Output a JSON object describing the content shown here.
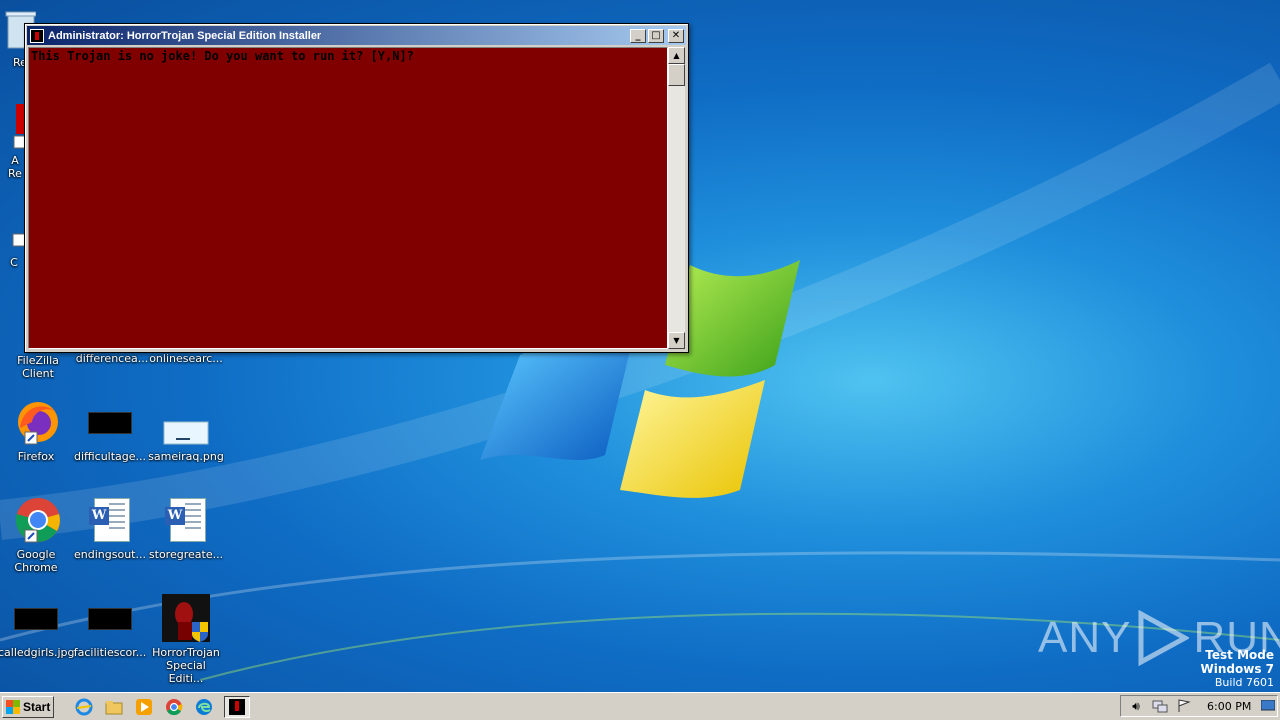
{
  "desktop": {
    "icons": [
      {
        "label": "Re",
        "kind": "recycle-bin"
      },
      {
        "label": "A",
        "kind": "partial-app"
      },
      {
        "label": "Re",
        "kind": "partial-app"
      },
      {
        "label": "C",
        "kind": "partial-app"
      },
      {
        "label": "FileZilla Client",
        "kind": "filezilla"
      },
      {
        "label": "differencea...",
        "kind": "word-doc"
      },
      {
        "label": "onlinesearc...",
        "kind": "word-doc"
      },
      {
        "label": "Firefox",
        "kind": "firefox"
      },
      {
        "label": "difficultage...",
        "kind": "black-image"
      },
      {
        "label": "sameiraq.png",
        "kind": "blank-image"
      },
      {
        "label": "Google Chrome",
        "kind": "chrome"
      },
      {
        "label": "endingsout...",
        "kind": "word-doc"
      },
      {
        "label": "storegreate...",
        "kind": "word-doc"
      },
      {
        "label": "calledgirls.jpg",
        "kind": "black-image"
      },
      {
        "label": "facilitiescor...",
        "kind": "black-image"
      },
      {
        "label": "HorrorTrojan Special Editi...",
        "kind": "installer"
      }
    ]
  },
  "window": {
    "title": "Administrator:  HorrorTrojan Special Edition Installer",
    "console_text": "This Trojan is no joke! Do you want to run it? [Y,N]?",
    "console_bg": "#800000",
    "buttons": {
      "minimize": "_",
      "maximize": "□",
      "close": "✕"
    }
  },
  "watermark": {
    "left": "ANY",
    "right": "RUN"
  },
  "test_mode": {
    "line1": "Test Mode",
    "line2": "Windows 7",
    "line3": "Build 7601"
  },
  "taskbar": {
    "start_label": "Start",
    "quick_launch": [
      "internet-explorer-icon",
      "explorer-icon",
      "media-player-icon",
      "chrome-icon",
      "edge-icon"
    ],
    "clock": "6:00 PM"
  }
}
